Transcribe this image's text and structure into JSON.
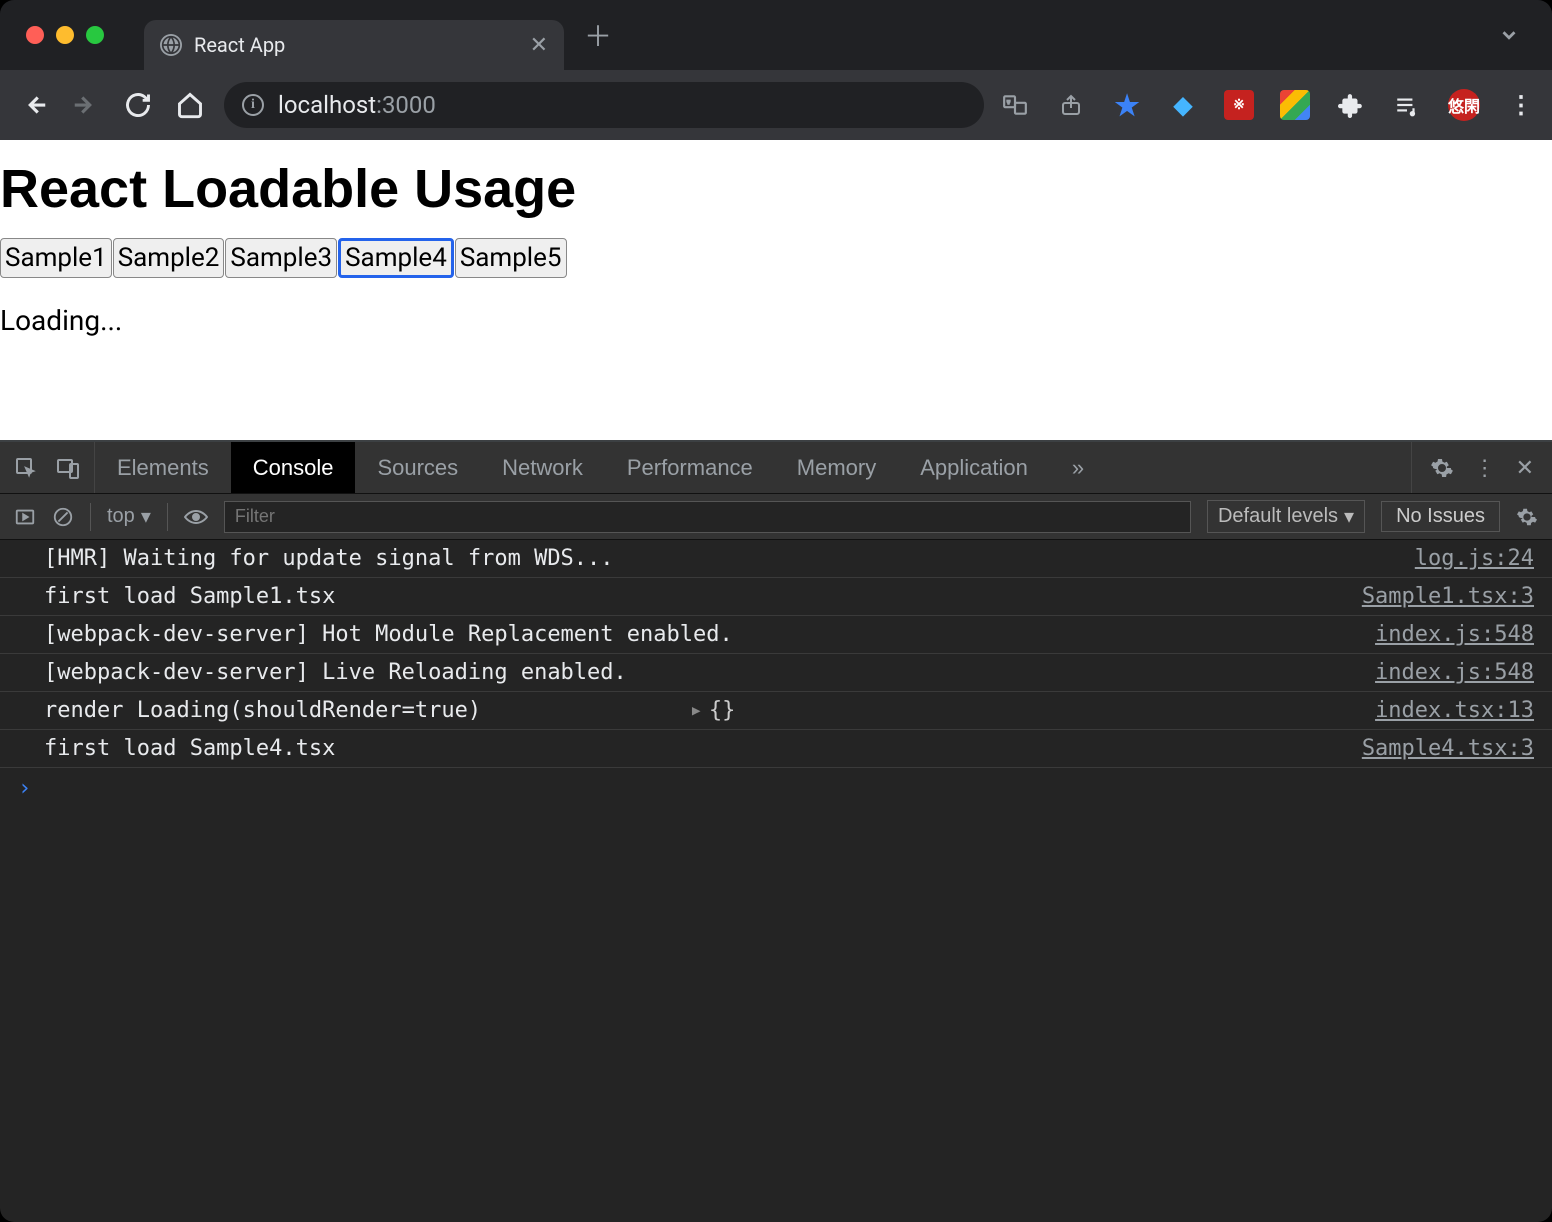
{
  "browser": {
    "tab_title": "React App",
    "url_host": "localhost",
    "url_port": ":3000"
  },
  "page": {
    "heading": "React Loadable Usage",
    "buttons": [
      "Sample1",
      "Sample2",
      "Sample3",
      "Sample4",
      "Sample5"
    ],
    "active_button_index": 3,
    "loading_text": "Loading..."
  },
  "devtools": {
    "tabs": [
      "Elements",
      "Console",
      "Sources",
      "Network",
      "Performance",
      "Memory",
      "Application"
    ],
    "active_tab_index": 1,
    "more_tabs_glyph": "»",
    "context_label": "top",
    "filter_placeholder": "Filter",
    "levels_label": "Default levels",
    "issues_label": "No Issues",
    "logs": [
      {
        "msg": "[HMR] Waiting for update signal from WDS...",
        "src": "log.js:24"
      },
      {
        "msg": "first load Sample1.tsx",
        "src": "Sample1.tsx:3"
      },
      {
        "msg": "[webpack-dev-server] Hot Module Replacement enabled.",
        "src": "index.js:548"
      },
      {
        "msg": "[webpack-dev-server] Live Reloading enabled.",
        "src": "index.js:548"
      },
      {
        "msg": "render Loading(shouldRender=true)",
        "expand": true,
        "obj": "{}",
        "src": "index.tsx:13"
      },
      {
        "msg": "first load Sample4.tsx",
        "src": "Sample4.tsx:3"
      }
    ],
    "prompt_glyph": "›"
  }
}
